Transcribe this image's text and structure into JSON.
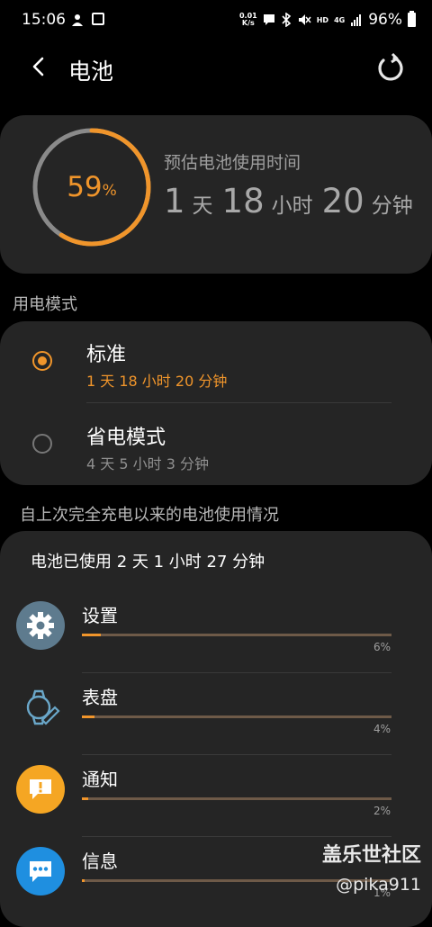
{
  "status_bar": {
    "time": "15:06",
    "net_speed_value": "0.01",
    "net_speed_unit": "K/s",
    "hd_label": "HD",
    "signal_label": "4G",
    "battery_percent": "96%"
  },
  "app_bar": {
    "title": "电池"
  },
  "summary": {
    "battery_level": 59,
    "battery_num": "59",
    "battery_unit": "%",
    "estimate_label": "预估电池使用时间",
    "days": "1",
    "days_unit": "天",
    "hours": "18",
    "hours_unit": "小时",
    "minutes": "20",
    "minutes_unit": "分钟"
  },
  "power_mode": {
    "section_label": "用电模式",
    "modes": [
      {
        "title": "标准",
        "estimate": "1 天 18 小时 20 分钟",
        "selected": true
      },
      {
        "title": "省电模式",
        "estimate": "4 天 5 小时 3 分钟",
        "selected": false
      }
    ]
  },
  "usage": {
    "section_label": "自上次完全充电以来的电池使用情况",
    "total_text": "电池已使用 2 天 1 小时 27 分钟",
    "apps": [
      {
        "name": "设置",
        "percent": "6%",
        "level": 0.06,
        "icon": "gear-icon"
      },
      {
        "name": "表盘",
        "percent": "4%",
        "level": 0.04,
        "icon": "watch-face-icon"
      },
      {
        "name": "通知",
        "percent": "2%",
        "level": 0.02,
        "icon": "alert-icon"
      },
      {
        "name": "信息",
        "percent": "1%",
        "level": 0.01,
        "icon": "message-icon"
      }
    ]
  },
  "watermark": {
    "line1": "盖乐世社区",
    "line2": "@pika911"
  },
  "colors": {
    "accent": "#f0952b",
    "background": "#000000",
    "card": "#252525"
  }
}
